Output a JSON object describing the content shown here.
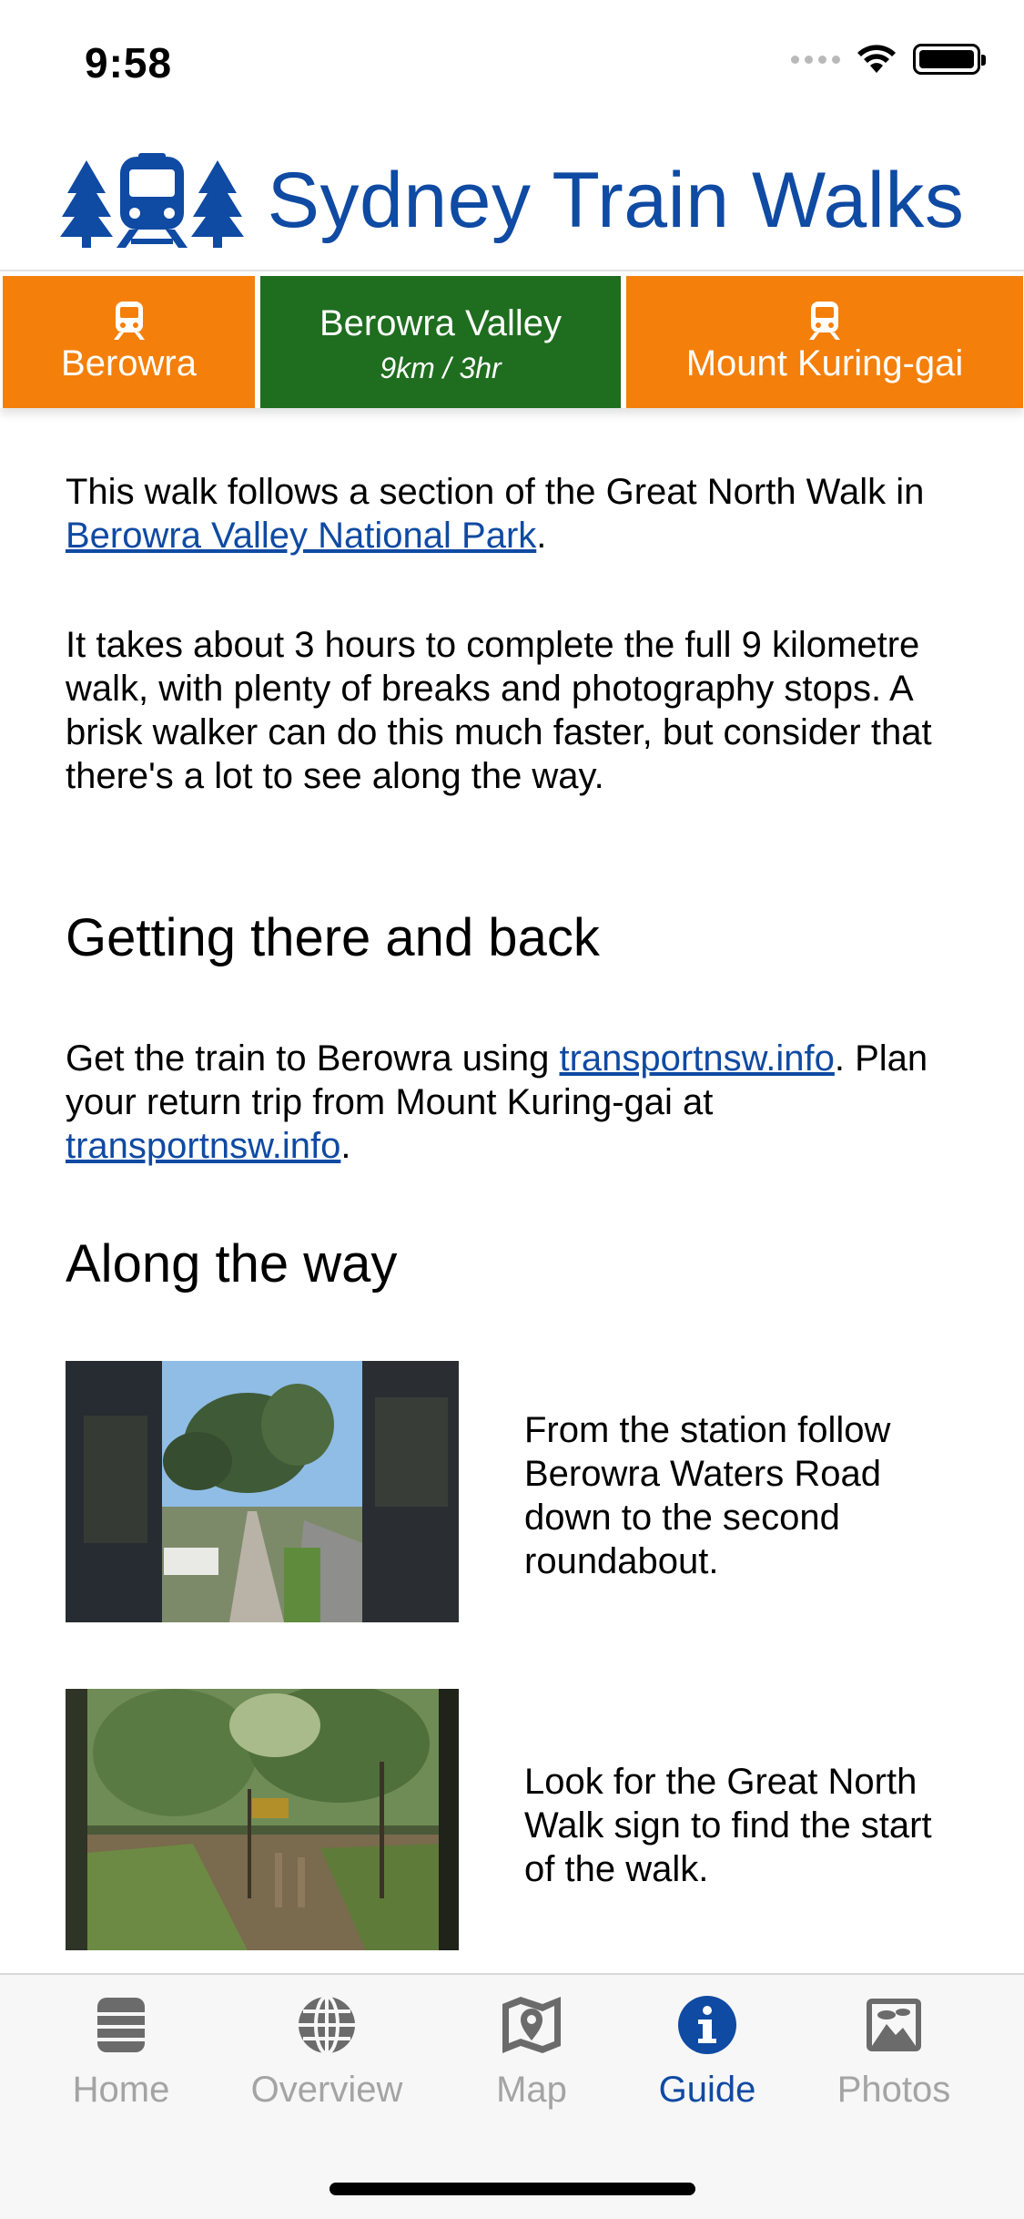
{
  "status_bar": {
    "time": "9:58"
  },
  "header": {
    "title": "Sydney Train Walks",
    "brand_color": "#0f4aa3"
  },
  "walk_nav": {
    "start_station": "Berowra",
    "walk_name": "Berowra Valley",
    "walk_details": "9km / 3hr",
    "end_station": "Mount Kuring-gai",
    "station_color": "#f47f0a",
    "walk_color": "#1f6d1f"
  },
  "guide": {
    "intro": {
      "text_before": "This walk follows a section of the Great North Walk in ",
      "link": "Berowra Valley National Park",
      "text_after": "."
    },
    "duration_text": "It takes about 3 hours to complete the full 9 kilometre walk, with plenty of breaks and photography stops. A brisk walker can do this much faster, but consider that there's a lot to see along the way.",
    "getting_there_heading": "Getting there and back",
    "getting_there": {
      "text1": "Get the train to Berowra using ",
      "link1": "transportnsw.info",
      "text2": ". Plan your return trip from Mount Kuring-gai at ",
      "link2": "transportnsw.info",
      "text3": "."
    },
    "along_heading": "Along the way",
    "stops": [
      {
        "text": "From the station follow Berowra Waters Road down to the second roundabout."
      },
      {
        "text": "Look for the Great North Walk sign to find the start of the walk."
      }
    ]
  },
  "tab_bar": {
    "active": "Guide",
    "tabs": [
      {
        "label": "Home",
        "icon": "home-icon"
      },
      {
        "label": "Overview",
        "icon": "globe-icon"
      },
      {
        "label": "Map",
        "icon": "map-icon"
      },
      {
        "label": "Guide",
        "icon": "info-icon"
      },
      {
        "label": "Photos",
        "icon": "photos-icon"
      }
    ]
  }
}
